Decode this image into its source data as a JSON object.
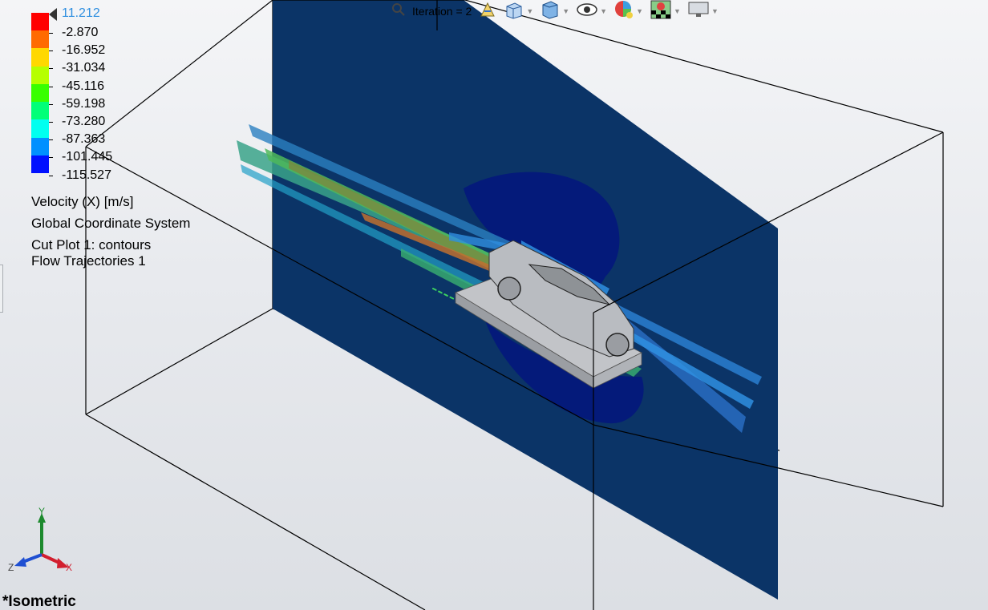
{
  "legend": {
    "max_value": "11.212",
    "values": [
      "-2.870",
      "-16.952",
      "-31.034",
      "-45.116",
      "-59.198",
      "-73.280",
      "-87.363",
      "-101.445",
      "-115.527"
    ],
    "colors": [
      "#ff0000",
      "#ff6a00",
      "#ffd800",
      "#b6ff00",
      "#38ff00",
      "#00ff78",
      "#00fff0",
      "#0090ff",
      "#0010ff"
    ],
    "parameter": "Velocity (X) [m/s]",
    "coordinate_system": "Global Coordinate System",
    "plot_1": "Cut Plot 1: contours",
    "plot_2": "Flow Trajectories 1"
  },
  "toolbar": {
    "iteration_label": "Iteration = 2",
    "icons": [
      "search-icon",
      "rotate-icon",
      "section-view-icon",
      "view-orientation-icon",
      "display-style-icon",
      "hide-show-icon",
      "appearance-icon",
      "scene-icon",
      "monitor-icon"
    ]
  },
  "view": {
    "name": "*Isometric"
  },
  "triad": {
    "x_label": "X",
    "y_label": "Y",
    "z_label": "Z",
    "x_color": "#d21f2f",
    "y_color": "#1d8a2e",
    "z_color": "#1f4fd2"
  },
  "colors": {
    "cut_plane": "#0b3467",
    "dark_region": "#041a7a",
    "box_edge": "#000000"
  }
}
